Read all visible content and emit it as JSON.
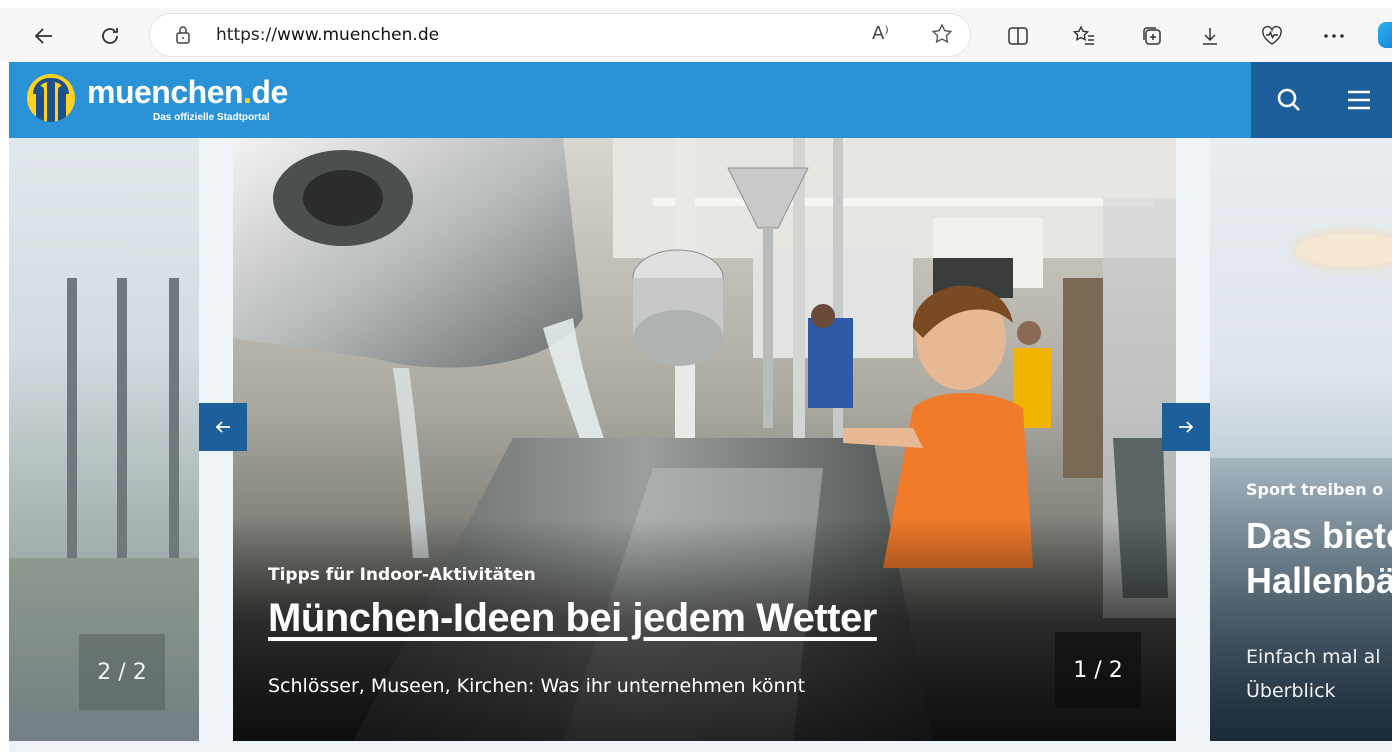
{
  "browser": {
    "url_scheme": "https://",
    "url_host": "www.muenchen.de",
    "read_aloud_glyph": "A⁾"
  },
  "site": {
    "logo_word_main": "muenchen",
    "logo_word_dot": ".",
    "logo_word_tld": "de",
    "logo_tagline": "Das offizielle Stadtportal",
    "brand_color": "#2a93d8",
    "dark_color": "#1c5f9b"
  },
  "carousel": {
    "left_slide": {
      "counter": "2 / 2"
    },
    "main_slide": {
      "kicker": "Tipps für Indoor-Aktivitäten",
      "headline": "München-Ideen bei jedem Wetter",
      "subline": "Schlösser, Museen, Kirchen: Was ihr unternehmen könnt",
      "counter": "1 / 2"
    },
    "right_slide": {
      "kicker": "Sport treiben o",
      "title_line1": "Das biete",
      "title_line2": "Hallenbä",
      "desc_line1": "Einfach mal al",
      "desc_line2": "Überblick"
    }
  },
  "icons": {
    "back": "arrow-left-icon",
    "refresh": "refresh-icon",
    "lock": "lock-icon",
    "favorite": "star-icon",
    "split": "split-screen-icon",
    "favorites_list": "favorites-icon",
    "collections": "collections-icon",
    "download": "download-icon",
    "health": "browser-essentials-icon",
    "more": "more-icon",
    "search": "search-icon",
    "menu": "hamburger-menu-icon",
    "prev": "arrow-left-icon",
    "next": "arrow-right-icon"
  }
}
